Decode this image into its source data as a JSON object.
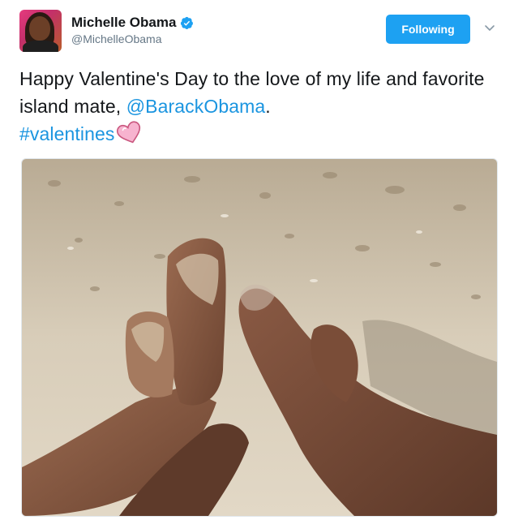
{
  "author": {
    "display_name": "Michelle Obama",
    "handle": "@MichelleObama",
    "verified": true,
    "verified_icon": "verified-badge-icon",
    "avatar": "profile-photo"
  },
  "follow_button": {
    "label": "Following"
  },
  "menu": {
    "icon": "chevron-down-icon"
  },
  "tweet": {
    "text_part1": "Happy Valentine's Day to the love of my life and favorite island mate, ",
    "mention": "@BarackObama",
    "text_part2": ".",
    "hashtag": "#valentines",
    "emoji": "pink-heart-emoji"
  },
  "media": {
    "type": "photo"
  },
  "colors": {
    "accent": "#1da1f2",
    "link": "#1b95e0",
    "text": "#14171a",
    "secondary": "#657786"
  }
}
